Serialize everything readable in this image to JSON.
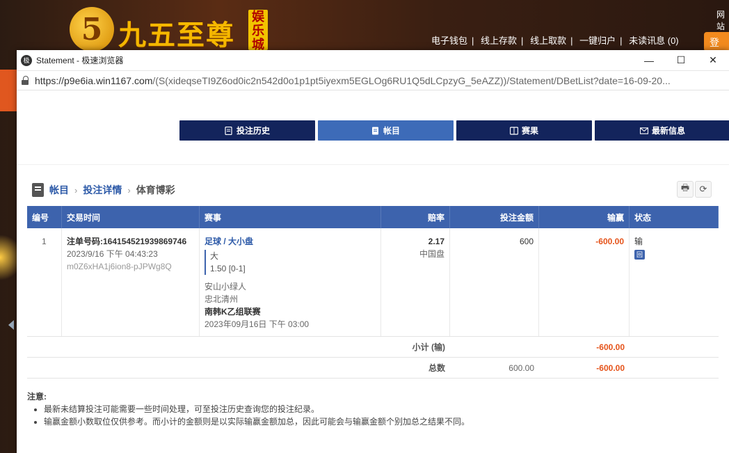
{
  "background": {
    "logo_glyph": "5",
    "brand": "九五至尊",
    "brand_badge": "娱乐城",
    "nav": [
      "电子钱包",
      "线上存款",
      "线上取款",
      "一键归户",
      "未读讯息 (0)"
    ],
    "top_right": "网站",
    "login": "登"
  },
  "window": {
    "title": "Statement - 极速浏览器",
    "app_icon": "极",
    "minimize": "—",
    "maximize": "☐",
    "close": "✕"
  },
  "address": {
    "host": "https://p9e6ia.win1167.com",
    "path": "/(S(xideqseTI9Z6od0ic2n542d0o1p1pt5iyexm5EGLOg6RU1Q5dLCpzyG_5eAZZ))/Statement/DBetList?date=16-09-20..."
  },
  "tabs": [
    {
      "label": "投注历史",
      "icon": "receipt-icon"
    },
    {
      "label": "帐目",
      "icon": "ledger-icon"
    },
    {
      "label": "赛果",
      "icon": "scoreboard-icon"
    },
    {
      "label": "最新信息",
      "icon": "mail-icon"
    }
  ],
  "breadcrumb": {
    "root": "帐目",
    "sep": "›",
    "middle": "投注详情",
    "current": "体育博彩"
  },
  "tools": {
    "print": "🖶",
    "refresh": "⟳"
  },
  "table": {
    "headers": {
      "no": "编号",
      "time": "交易时间",
      "event": "赛事",
      "odds": "赔率",
      "stake": "投注金额",
      "winloss": "输赢",
      "status": "状态"
    },
    "row": {
      "no": "1",
      "bet_id": "注单号码:164154521939869746",
      "datetime": "2023/9/16 下午 04:43:23",
      "ref": "m0Z6xHA1j6ion8-pJPWg8Q",
      "market": "足球 / 大小盘",
      "selection": "大",
      "line": "1.50 [0-1]",
      "home": "安山小绿人",
      "away": "忠北清州",
      "league": "南韩K乙组联赛",
      "kickoff": "2023年09月16日 下午 03:00",
      "odds": "2.17",
      "odds_type": "中国盘",
      "stake": "600",
      "winloss": "-600.00",
      "status": "输",
      "status_icon": "回"
    },
    "subtotal": {
      "label": "小计 (输)",
      "winloss": "-600.00"
    },
    "total": {
      "label": "总数",
      "stake": "600.00",
      "winloss": "-600.00"
    }
  },
  "notes": {
    "title": "注意:",
    "items": [
      "最新未结算投注可能需要一些时间处理，可至投注历史查询您的投注纪录。",
      "输赢金额小数取位仅供参考。而小计的金额则是以实际输赢金额加总，因此可能会与输赢金额个别加总之结果不同。"
    ]
  }
}
